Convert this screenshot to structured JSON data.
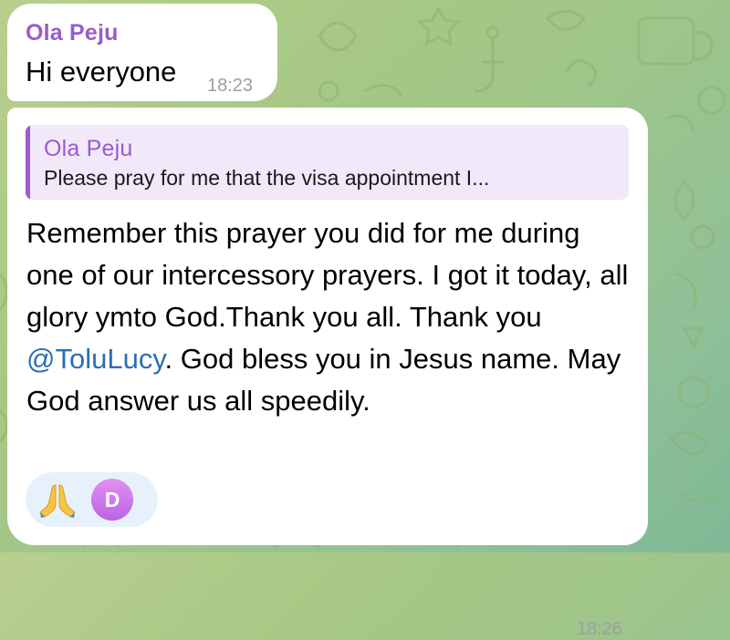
{
  "messages": [
    {
      "sender": "Ola Peju",
      "text": "Hi everyone",
      "time": "18:23"
    },
    {
      "reply": {
        "sender": "Ola Peju",
        "text": "Please pray for me that the visa appointment I..."
      },
      "body_part1": "Remember this prayer you did for me during one of our intercessory prayers. I got it today, all glory ymto God.Thank you all. Thank you ",
      "mention": "@ToluLucy",
      "body_part2": ". God bless you in Jesus name. May God answer us all speedily.",
      "reaction": {
        "emoji_icon": "praying-hands-icon",
        "avatar_initial": "D"
      },
      "time": "18:26"
    }
  ],
  "colors": {
    "sender_name": "#9b5bc8",
    "mention": "#2a6fb5",
    "reply_background": "#f1e8fa",
    "reaction_background": "#e7f1fb",
    "timestamp": "#9aa0a6"
  }
}
